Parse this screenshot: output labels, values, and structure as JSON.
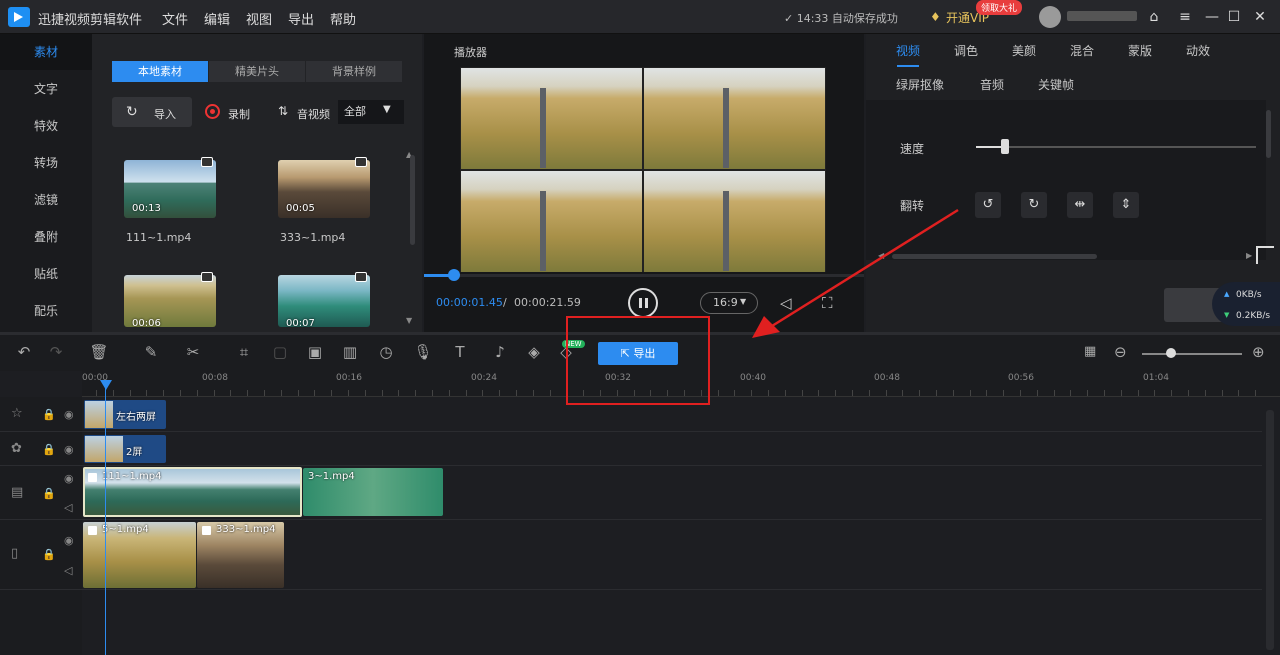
{
  "titlebar": {
    "app_title": "迅捷视频剪辑软件",
    "menus": [
      "文件",
      "编辑",
      "视图",
      "导出",
      "帮助"
    ],
    "saved_status": "✓ 14:33 自动保存成功",
    "vip_label": "开通VIP",
    "vip_badge": "领取大礼",
    "window_buttons": [
      "home-icon",
      "menu-icon",
      "minimize-icon",
      "maximize-icon",
      "close-icon"
    ]
  },
  "sidebar": {
    "items": [
      "素材",
      "文字",
      "特效",
      "转场",
      "滤镜",
      "叠附",
      "贴纸",
      "配乐"
    ],
    "active_index": 0
  },
  "media": {
    "tabs": [
      "本地素材",
      "精美片头",
      "背景样例"
    ],
    "active_tab": 0,
    "import_label": "导入",
    "record_label": "录制",
    "sort_label": "音视频",
    "filter_value": "全部",
    "items": [
      {
        "name": "111~1.mp4",
        "duration": "00:13"
      },
      {
        "name": "333~1.mp4",
        "duration": "00:05"
      },
      {
        "name": "",
        "duration": "00:06"
      },
      {
        "name": "",
        "duration": "00:07"
      }
    ]
  },
  "player": {
    "title": "播放器",
    "current_time": "00:00:01.45",
    "separator": "/",
    "total_time": "00:00:21.59",
    "aspect_ratio": "16:9",
    "progress": 0.07
  },
  "properties": {
    "tabs_row1": [
      "视频",
      "调色",
      "美颜",
      "混合",
      "蒙版",
      "动效"
    ],
    "tabs_row2": [
      "绿屏抠像",
      "音频",
      "关键帧"
    ],
    "active_tab": "视频",
    "speed_label": "速度",
    "speed_value": 0.1,
    "flip_label": "翻转",
    "flip_icons": [
      "rotate-left-icon",
      "rotate-right-icon",
      "flip-horizontal-icon",
      "flip-vertical-icon"
    ],
    "net_up": "0KB/s",
    "net_down": "0.2KB/s"
  },
  "toolbar": {
    "export_label": "导出",
    "new_badge": "NEW",
    "zoom_level": 0.3
  },
  "timeline": {
    "ruler_labels": [
      "00:00",
      "00:08",
      "00:16",
      "00:24",
      "00:32",
      "00:40",
      "00:48",
      "00:56",
      "01:04"
    ],
    "tracks": [
      {
        "type": "effect",
        "clips": [
          {
            "label": "左右两屏"
          }
        ]
      },
      {
        "type": "effect",
        "clips": [
          {
            "label": "2屏"
          }
        ]
      },
      {
        "type": "video",
        "clips": [
          {
            "label": "111~1.mp4"
          },
          {
            "label": "3~1.mp4"
          }
        ]
      },
      {
        "type": "video",
        "clips": [
          {
            "label": "5~1.mp4"
          },
          {
            "label": "333~1.mp4"
          }
        ]
      }
    ]
  },
  "colors": {
    "accent": "#2d8cf0",
    "annotation": "#e02020",
    "background": "#1d1e22"
  }
}
